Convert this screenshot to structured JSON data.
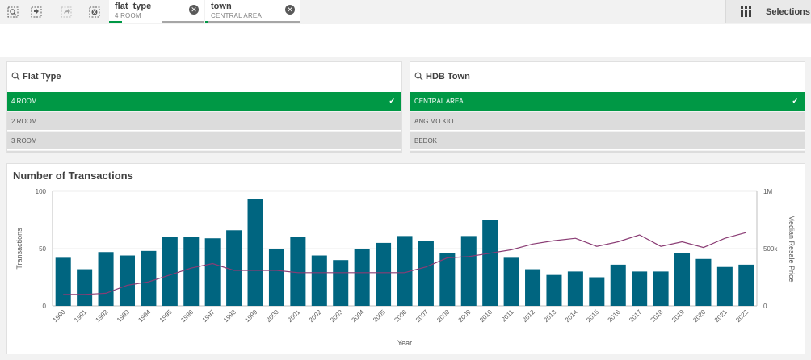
{
  "toolbar": {
    "tools": [
      "smart-search-icon",
      "selections-tool-icon",
      "step-forward-icon",
      "clear-all-icon"
    ],
    "chips": [
      {
        "field": "flat_type",
        "value": "4 ROOM"
      },
      {
        "field": "town",
        "value": "CENTRAL AREA"
      }
    ],
    "selections_label": "Selections"
  },
  "panes": [
    {
      "title": "Flat Type",
      "items": [
        "4 ROOM",
        "2 ROOM",
        "3 ROOM"
      ],
      "selected": "4 ROOM"
    },
    {
      "title": "HDB Town",
      "items": [
        "CENTRAL AREA",
        "ANG MO KIO",
        "BEDOK"
      ],
      "selected": "CENTRAL AREA"
    }
  ],
  "colors": {
    "selected_green": "#009845",
    "bar": "#006580",
    "line": "#8a3c74",
    "chip_bar_gray": "#a6a6a6"
  },
  "chart_data": {
    "type": "bar",
    "title": "Number of Transactions",
    "xlabel": "Year",
    "ylabel": "Transactions",
    "y2label": "Median Resale Price",
    "ylim": [
      0,
      100
    ],
    "y2lim": [
      0,
      1000000
    ],
    "yticks": [
      "0",
      "50",
      "100"
    ],
    "y2ticks": [
      "0",
      "500k",
      "1M"
    ],
    "grid": true,
    "categories": [
      "1990",
      "1991",
      "1992",
      "1993",
      "1994",
      "1995",
      "1996",
      "1997",
      "1998",
      "1999",
      "2000",
      "2001",
      "2002",
      "2003",
      "2004",
      "2005",
      "2006",
      "2007",
      "2008",
      "2009",
      "2010",
      "2011",
      "2012",
      "2013",
      "2014",
      "2015",
      "2016",
      "2017",
      "2018",
      "2019",
      "2020",
      "2021",
      "2022"
    ],
    "series": [
      {
        "name": "Transactions",
        "type": "bar",
        "values": [
          42,
          32,
          47,
          44,
          48,
          60,
          60,
          59,
          66,
          93,
          50,
          60,
          44,
          40,
          50,
          55,
          61,
          57,
          46,
          61,
          75,
          42,
          32,
          27,
          30,
          25,
          36,
          30,
          30,
          46,
          41,
          34,
          36
        ]
      },
      {
        "name": "Median Resale Price",
        "type": "line",
        "values": [
          100000,
          100000,
          110000,
          180000,
          210000,
          270000,
          330000,
          370000,
          310000,
          310000,
          310000,
          290000,
          290000,
          290000,
          290000,
          290000,
          290000,
          340000,
          420000,
          430000,
          460000,
          490000,
          540000,
          570000,
          590000,
          520000,
          560000,
          620000,
          520000,
          560000,
          510000,
          590000,
          640000
        ]
      }
    ]
  }
}
